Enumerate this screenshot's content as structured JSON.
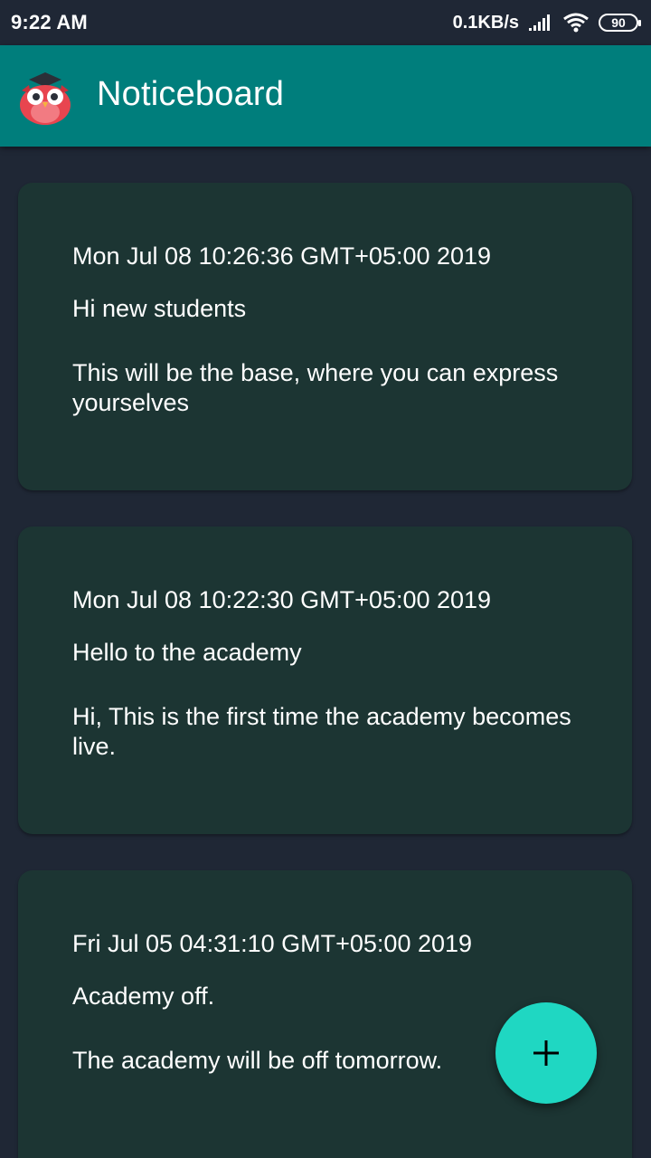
{
  "status_bar": {
    "time": "9:22 AM",
    "network_speed": "0.1KB/s",
    "battery": "90",
    "icons": [
      "signal-icon",
      "wifi-icon",
      "battery-icon"
    ]
  },
  "app_bar": {
    "title": "Noticeboard",
    "logo_icon": "owl-graduate-icon",
    "color": "#007e7c"
  },
  "notices": [
    {
      "date": "Mon Jul 08 10:26:36 GMT+05:00 2019",
      "title": "Hi new students",
      "body": "This will be the base, where you can express yourselves"
    },
    {
      "date": "Mon Jul 08 10:22:30 GMT+05:00 2019",
      "title": "Hello to the academy",
      "body": "Hi, This is the first time the academy becomes live."
    },
    {
      "date": "Fri Jul 05 04:31:10 GMT+05:00 2019",
      "title": "Academy off.",
      "body": "The academy will be off tomorrow."
    }
  ],
  "fab": {
    "icon": "plus-icon",
    "color": "#1fd7c2"
  },
  "colors": {
    "background": "#1f2735",
    "card": "#1c3533"
  }
}
